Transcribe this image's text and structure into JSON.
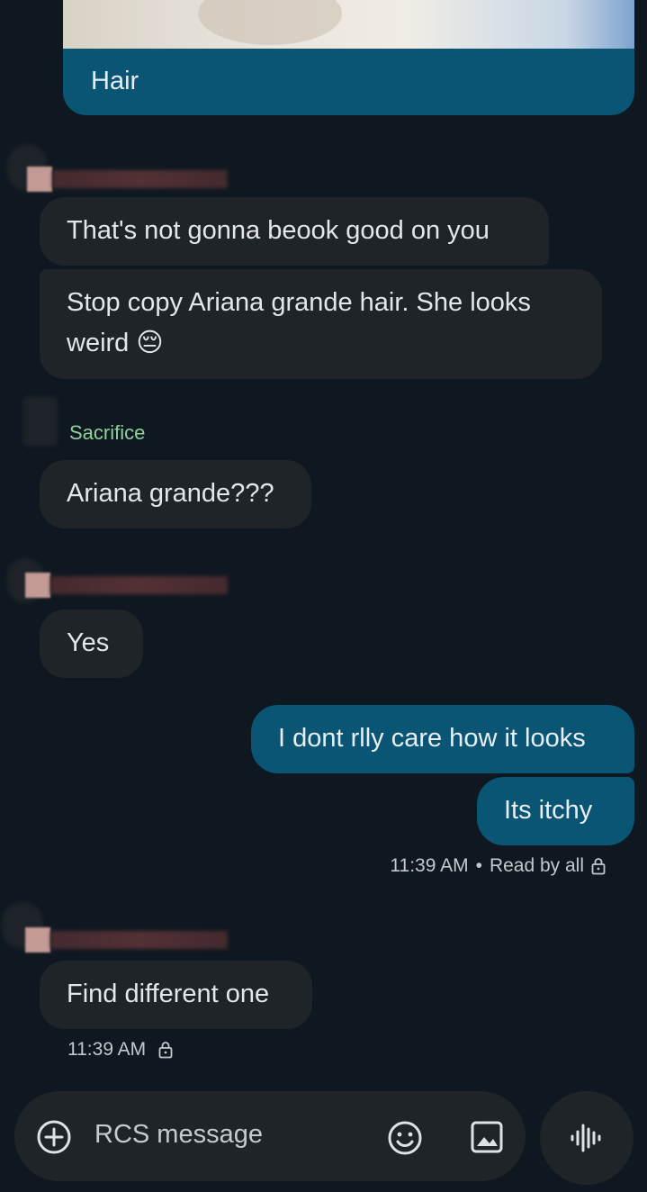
{
  "thread": {
    "image_caption": "Hair",
    "messages": [
      {
        "text": "That's not gonna beook good on you"
      },
      {
        "text": "Stop copy Ariana grande hair.  She looks weird 😔"
      },
      {
        "sender": "Sacrifice",
        "text": "Ariana grande???"
      },
      {
        "text": "Yes"
      },
      {
        "text": "I dont rlly care how it looks"
      },
      {
        "text": "Its itchy"
      },
      {
        "text": "Find different one"
      }
    ],
    "outgoing_meta": {
      "time": "11:39 AM",
      "separator": "•",
      "status": "Read by all"
    },
    "incoming_meta": {
      "time": "11:39 AM"
    }
  },
  "composer": {
    "placeholder": "RCS message",
    "icons": [
      "add-icon",
      "emoji-icon",
      "gallery-icon",
      "voice-icon"
    ]
  },
  "colors": {
    "background": "#0f1820",
    "incoming_bubble": "#1e2428",
    "outgoing_bubble": "#0a5474",
    "sender_name": "#8fd19a"
  }
}
